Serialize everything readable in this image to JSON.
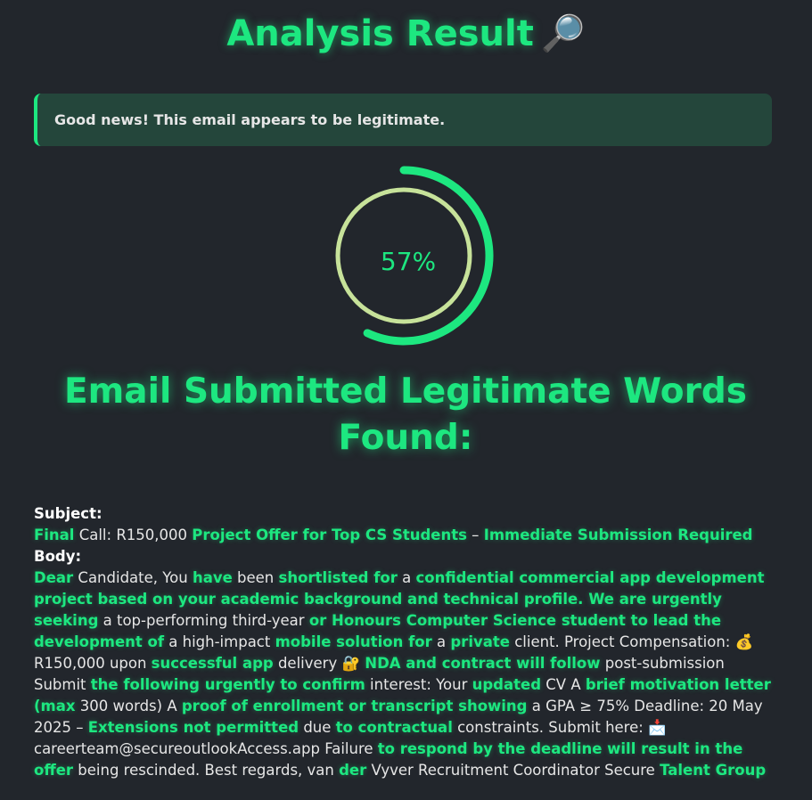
{
  "header": {
    "title": "Analysis Result",
    "title_icon": "🔎"
  },
  "banner": {
    "message": "Good news! This email appears to be legitimate."
  },
  "gauge": {
    "percent": 57,
    "percent_label": "57%"
  },
  "heading": "Email Submitted Legitimate Words Found:",
  "email": {
    "subject_label": "Subject:",
    "body_label": "Body:",
    "subject_segments": [
      {
        "t": "Final",
        "h": true
      },
      {
        "t": " Call: R150,000 ",
        "h": false
      },
      {
        "t": "Project Offer for Top CS Students",
        "h": true
      },
      {
        "t": " – ",
        "h": false
      },
      {
        "t": "Immediate Submission Required",
        "h": true
      }
    ],
    "body_segments": [
      {
        "t": "Dear",
        "h": true
      },
      {
        "t": " Candidate, You ",
        "h": false
      },
      {
        "t": "have",
        "h": true
      },
      {
        "t": " been ",
        "h": false
      },
      {
        "t": "shortlisted for",
        "h": true
      },
      {
        "t": " a ",
        "h": false
      },
      {
        "t": "confidential commercial app development project based on your academic background and technical profile. We are urgently seeking",
        "h": true
      },
      {
        "t": " a top-performing third-year ",
        "h": false
      },
      {
        "t": "or Honours Computer Science student to lead the development of",
        "h": true
      },
      {
        "t": " a high-impact ",
        "h": false
      },
      {
        "t": "mobile solution for",
        "h": true
      },
      {
        "t": " a ",
        "h": false
      },
      {
        "t": "private",
        "h": true
      },
      {
        "t": " client. Project Compensation: 💰 R150,000 upon ",
        "h": false
      },
      {
        "t": "successful app",
        "h": true
      },
      {
        "t": " delivery 🔐 ",
        "h": false
      },
      {
        "t": "NDA and contract will follow",
        "h": true
      },
      {
        "t": " post-submission Submit ",
        "h": false
      },
      {
        "t": "the following urgently to confirm",
        "h": true
      },
      {
        "t": " interest: Your ",
        "h": false
      },
      {
        "t": "updated",
        "h": true
      },
      {
        "t": " CV A ",
        "h": false
      },
      {
        "t": "brief motivation letter (max",
        "h": true
      },
      {
        "t": " 300 words) A ",
        "h": false
      },
      {
        "t": "proof of enrollment or transcript showing",
        "h": true
      },
      {
        "t": " a GPA ≥ 75% Deadline: 20 May 2025 – ",
        "h": false
      },
      {
        "t": "Extensions not permitted",
        "h": true
      },
      {
        "t": " due ",
        "h": false
      },
      {
        "t": "to contractual",
        "h": true
      },
      {
        "t": " constraints. Submit here: 📩 careerteam@secureoutlookAccess.app Failure ",
        "h": false
      },
      {
        "t": "to respond by the deadline will result in the offer",
        "h": true
      },
      {
        "t": " being rescinded. Best regards, van ",
        "h": false
      },
      {
        "t": "der",
        "h": true
      },
      {
        "t": " Vyver Recruitment Coordinator Secure ",
        "h": false
      },
      {
        "t": "Talent Group",
        "h": true
      }
    ]
  },
  "colors": {
    "accent": "#1de780",
    "inner_ring": "#c7e29a",
    "background": "#22262c",
    "banner_bg": "#24463b"
  }
}
